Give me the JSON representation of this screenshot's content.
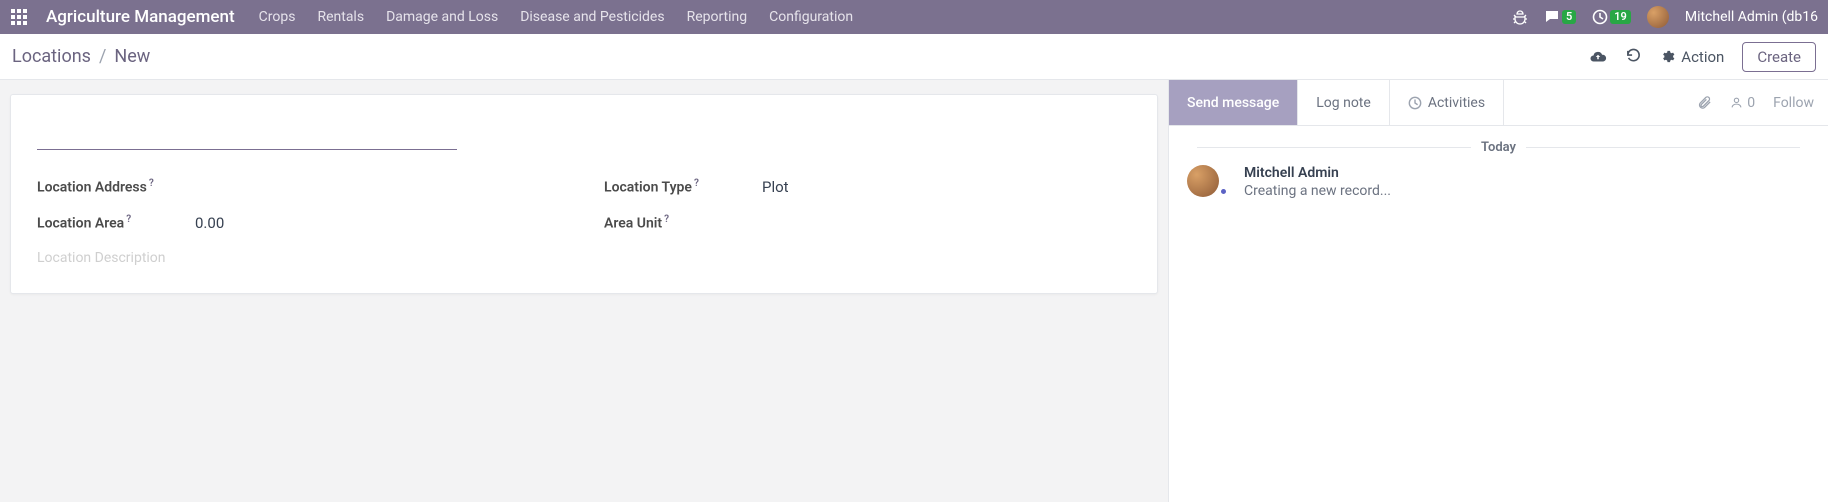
{
  "brand": "Agriculture Management",
  "nav": {
    "items": [
      "Crops",
      "Rentals",
      "Damage and Loss",
      "Disease and Pesticides",
      "Reporting",
      "Configuration"
    ]
  },
  "systray": {
    "chat_badge": "5",
    "activity_badge": "19",
    "user": "Mitchell Admin (db16"
  },
  "breadcrumb": {
    "root": "Locations",
    "current": "New"
  },
  "actions": {
    "action_label": "Action",
    "create_label": "Create"
  },
  "form": {
    "fields": {
      "location_address": {
        "label": "Location Address",
        "value": ""
      },
      "location_area": {
        "label": "Location Area",
        "value": "0.00"
      },
      "location_type": {
        "label": "Location Type",
        "value": "Plot"
      },
      "area_unit": {
        "label": "Area Unit",
        "value": ""
      }
    },
    "description_placeholder": "Location Description"
  },
  "chatter": {
    "tabs": {
      "send": "Send message",
      "log": "Log note",
      "activities": "Activities"
    },
    "followers_count": "0",
    "follow_label": "Follow",
    "date": "Today",
    "msg": {
      "author": "Mitchell Admin",
      "body": "Creating a new record..."
    }
  }
}
